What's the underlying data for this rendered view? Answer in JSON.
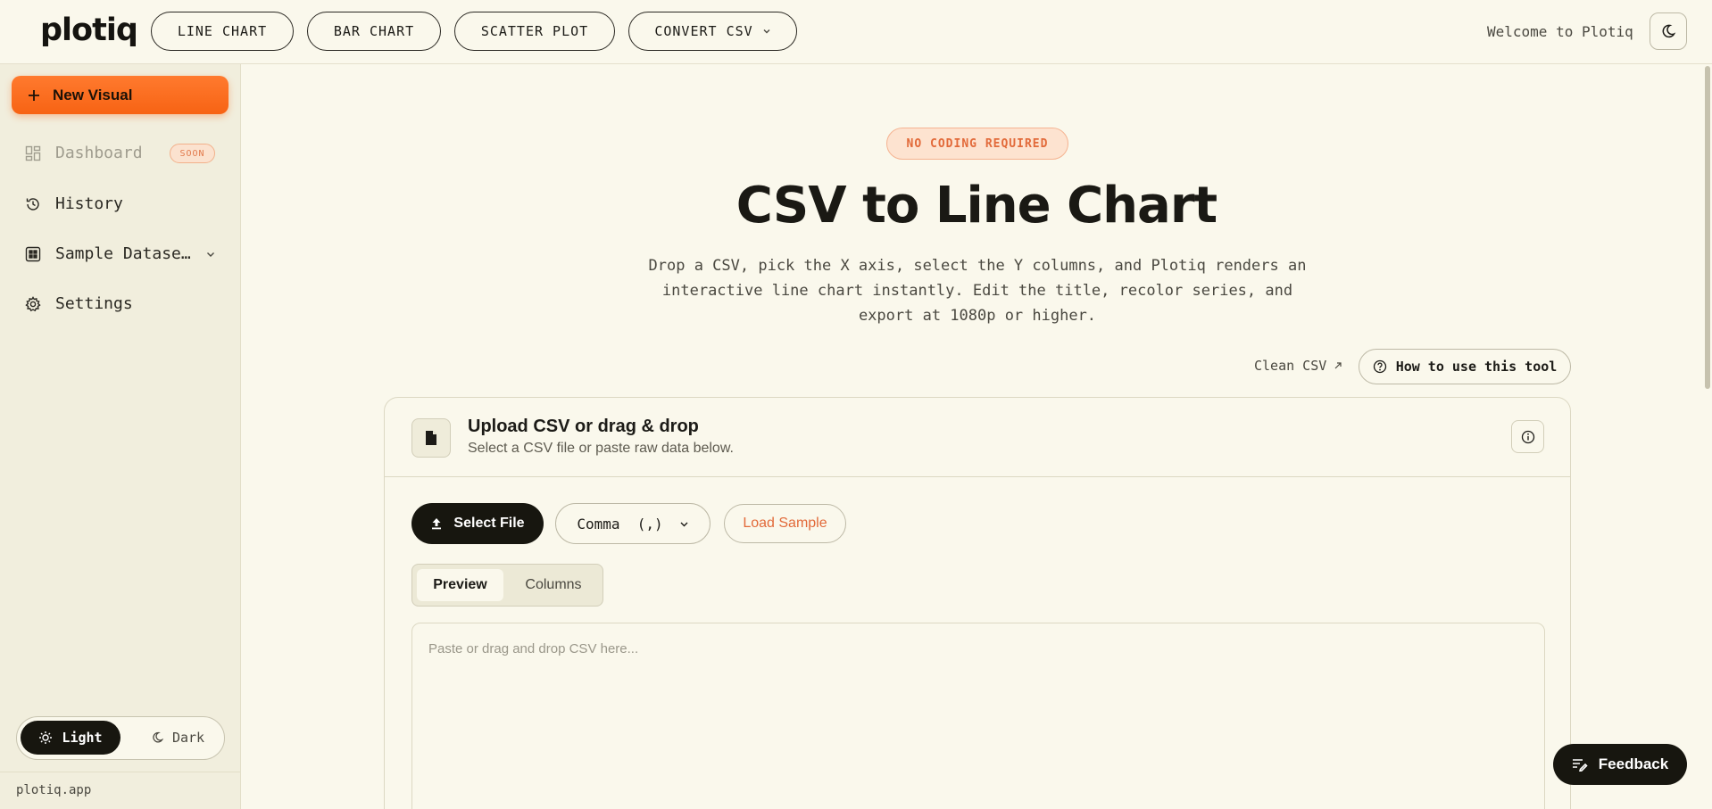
{
  "app": {
    "logo": "plotiq",
    "welcome": "Welcome to Plotiq"
  },
  "nav": [
    {
      "label": "LINE CHART"
    },
    {
      "label": "BAR CHART"
    },
    {
      "label": "SCATTER PLOT"
    },
    {
      "label": "CONVERT CSV",
      "has_dropdown": true
    }
  ],
  "sidebar": {
    "new_visual": "New Visual",
    "items": [
      {
        "label": "Dashboard",
        "badge": "SOON",
        "disabled": true,
        "icon": "dashboard-icon"
      },
      {
        "label": "History",
        "icon": "history-icon"
      },
      {
        "label": "Sample Datase…",
        "icon": "dataset-icon",
        "has_dropdown": true
      },
      {
        "label": "Settings",
        "icon": "gear-icon"
      }
    ],
    "theme": {
      "light": "Light",
      "dark": "Dark",
      "selected": "Light"
    },
    "footer": "plotiq.app"
  },
  "main": {
    "badge": "NO CODING REQUIRED",
    "title": "CSV to Line Chart",
    "description_lines": [
      "Drop a CSV, pick the X axis, select the Y columns, and Plotiq renders an",
      "interactive line chart instantly. Edit the title, recolor series, and",
      "export at 1080p or higher."
    ],
    "clean_csv": "Clean CSV",
    "how_to": "How to use this tool"
  },
  "upload": {
    "title": "Upload CSV or drag & drop",
    "subtitle": "Select a CSV file or paste raw data below.",
    "select_file": "Select File",
    "delimiter": "Comma  (,)",
    "load_sample": "Load Sample",
    "tabs": [
      {
        "label": "Preview",
        "active": true
      },
      {
        "label": "Columns",
        "active": false
      }
    ],
    "placeholder": "Paste or drag and drop CSV here..."
  },
  "feedback": "Feedback",
  "colors": {
    "accent": "#f76314",
    "background": "#faf8ec",
    "sidebar": "#f1eedd",
    "dark": "#17160f"
  }
}
